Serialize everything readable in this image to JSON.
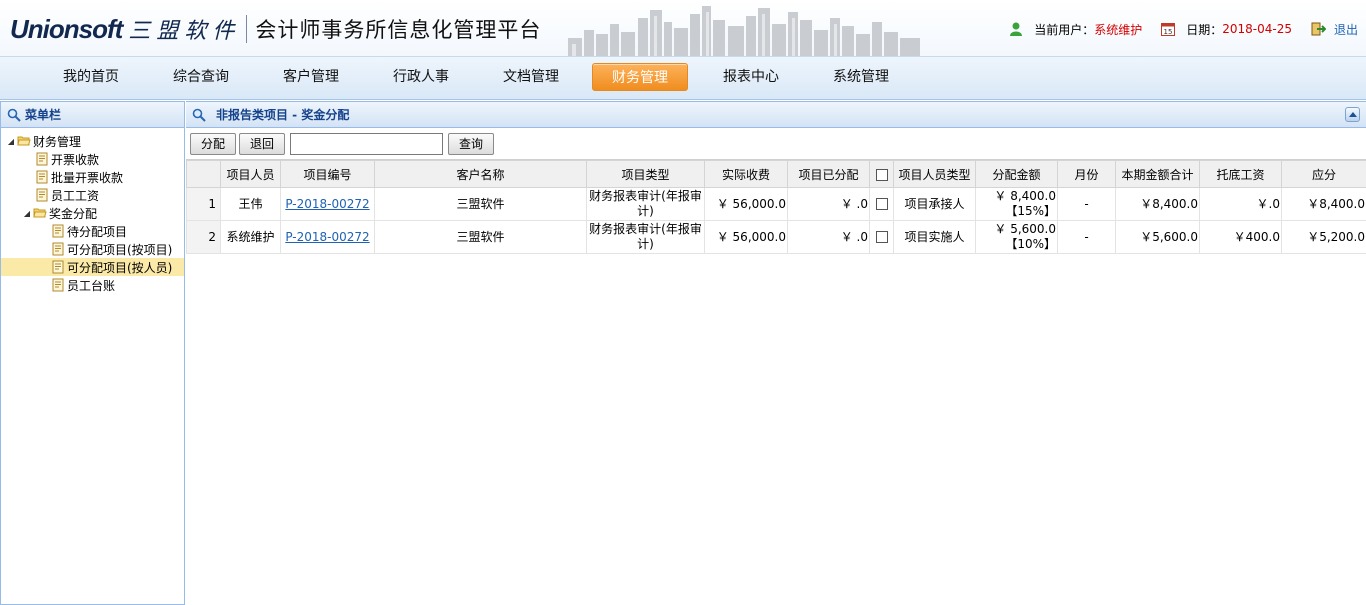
{
  "header": {
    "logo_en": "Unionsoft",
    "logo_cn": "三盟软件",
    "platform_title": "会计师事务所信息化管理平台",
    "user_label": "当前用户：",
    "user_value": "系统维护",
    "date_label": "日期：",
    "date_value": "2018-04-25",
    "logout_label": "退出"
  },
  "nav": {
    "items": [
      "我的首页",
      "综合查询",
      "客户管理",
      "行政人事",
      "文档管理",
      "财务管理",
      "报表中心",
      "系统管理"
    ],
    "active": "财务管理"
  },
  "sidebar": {
    "title": "菜单栏",
    "tree": {
      "root": "财务管理",
      "items": [
        "开票收款",
        "批量开票收款",
        "员工工资"
      ],
      "group": "奖金分配",
      "group_items": [
        "待分配项目",
        "可分配项目(按项目)",
        "可分配项目(按人员)",
        "员工台账"
      ],
      "selected": "可分配项目(按人员)"
    }
  },
  "main": {
    "title": "非报告类项目 - 奖金分配",
    "toolbar": {
      "distribute_label": "分配",
      "return_label": "退回",
      "search_value": "",
      "query_label": "查询"
    },
    "columns": [
      "项目人员",
      "项目编号",
      "客户名称",
      "项目类型",
      "实际收费",
      "项目已分配",
      "项目人员类型",
      "分配金额",
      "月份",
      "本期金额合计",
      "托底工资",
      "应分"
    ],
    "rows": [
      {
        "no": "1",
        "person": "王伟",
        "project_no": "P-2018-00272",
        "client": "三盟软件",
        "type": "财务报表审计(年报审计)",
        "fee": "￥ 56,000.0",
        "allocated": "￥ .0",
        "person_type": "项目承接人",
        "amount": "￥ 8,400.0",
        "amount_pct": "【15%】",
        "month": "-",
        "period_total": "￥8,400.0",
        "base_salary": "￥.0",
        "due": "￥8,400.0"
      },
      {
        "no": "2",
        "person": "系统维护",
        "project_no": "P-2018-00272",
        "client": "三盟软件",
        "type": "财务报表审计(年报审计)",
        "fee": "￥ 56,000.0",
        "allocated": "￥ .0",
        "person_type": "项目实施人",
        "amount": "￥ 5,600.0",
        "amount_pct": "【10%】",
        "month": "-",
        "period_total": "￥5,600.0",
        "base_salary": "￥400.0",
        "due": "￥5,200.0"
      }
    ]
  },
  "colors": {
    "accent_orange": "#f08d1f",
    "link_blue": "#1e63b4",
    "header_red": "#d40000",
    "panel_title": "#15428b"
  }
}
